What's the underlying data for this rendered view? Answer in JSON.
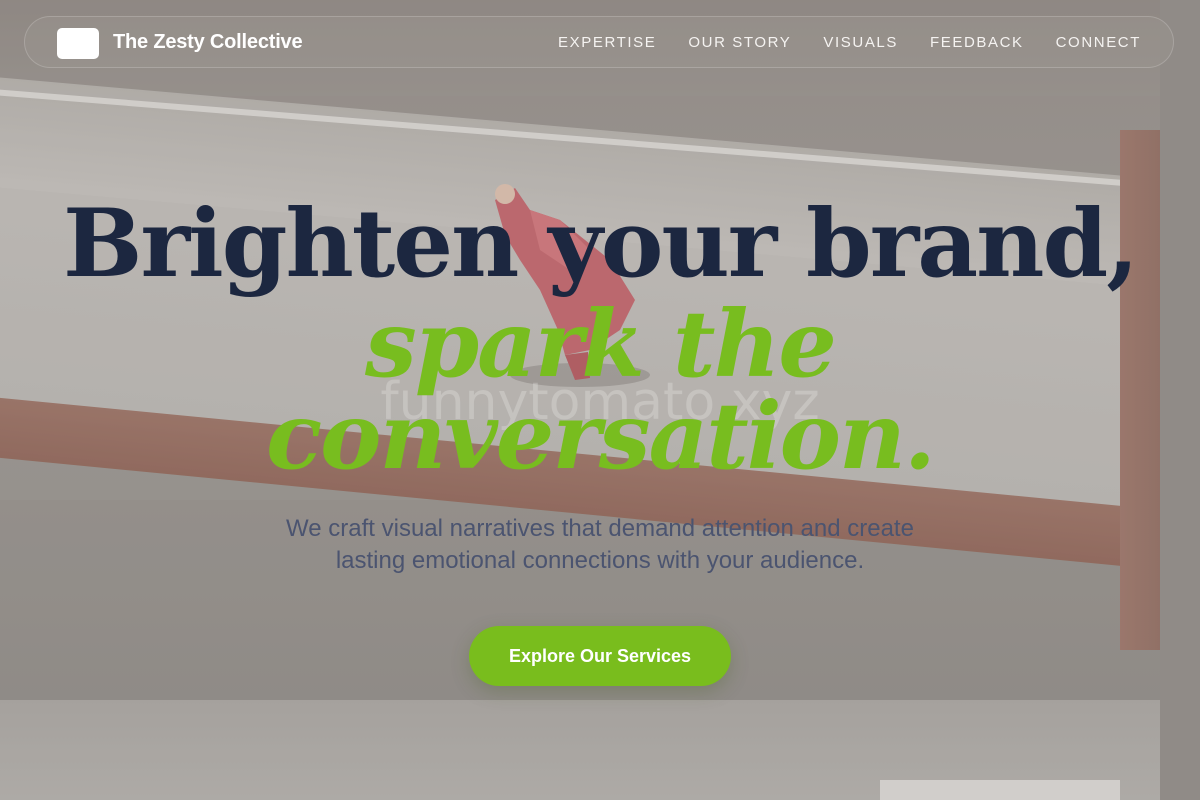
{
  "brand": {
    "name": "The Zesty Collective"
  },
  "nav": {
    "links": [
      {
        "label": "EXPERTISE"
      },
      {
        "label": "OUR STORY"
      },
      {
        "label": "VISUALS"
      },
      {
        "label": "FEEDBACK"
      },
      {
        "label": "CONNECT"
      }
    ]
  },
  "hero": {
    "headline_line1": "Brighten your brand,",
    "headline_line2": "spark the",
    "headline_line3": "conversation.",
    "subtitle": "We craft visual narratives that demand attention and create lasting emotional connections with your audience.",
    "cta_label": "Explore Our Services"
  },
  "watermark": "funnytomato.xyz",
  "colors": {
    "headline_dark": "#1c2740",
    "accent_green": "#79bd1d",
    "subtitle_slate": "#4b5470",
    "nav_text": "#f5f3f1"
  }
}
